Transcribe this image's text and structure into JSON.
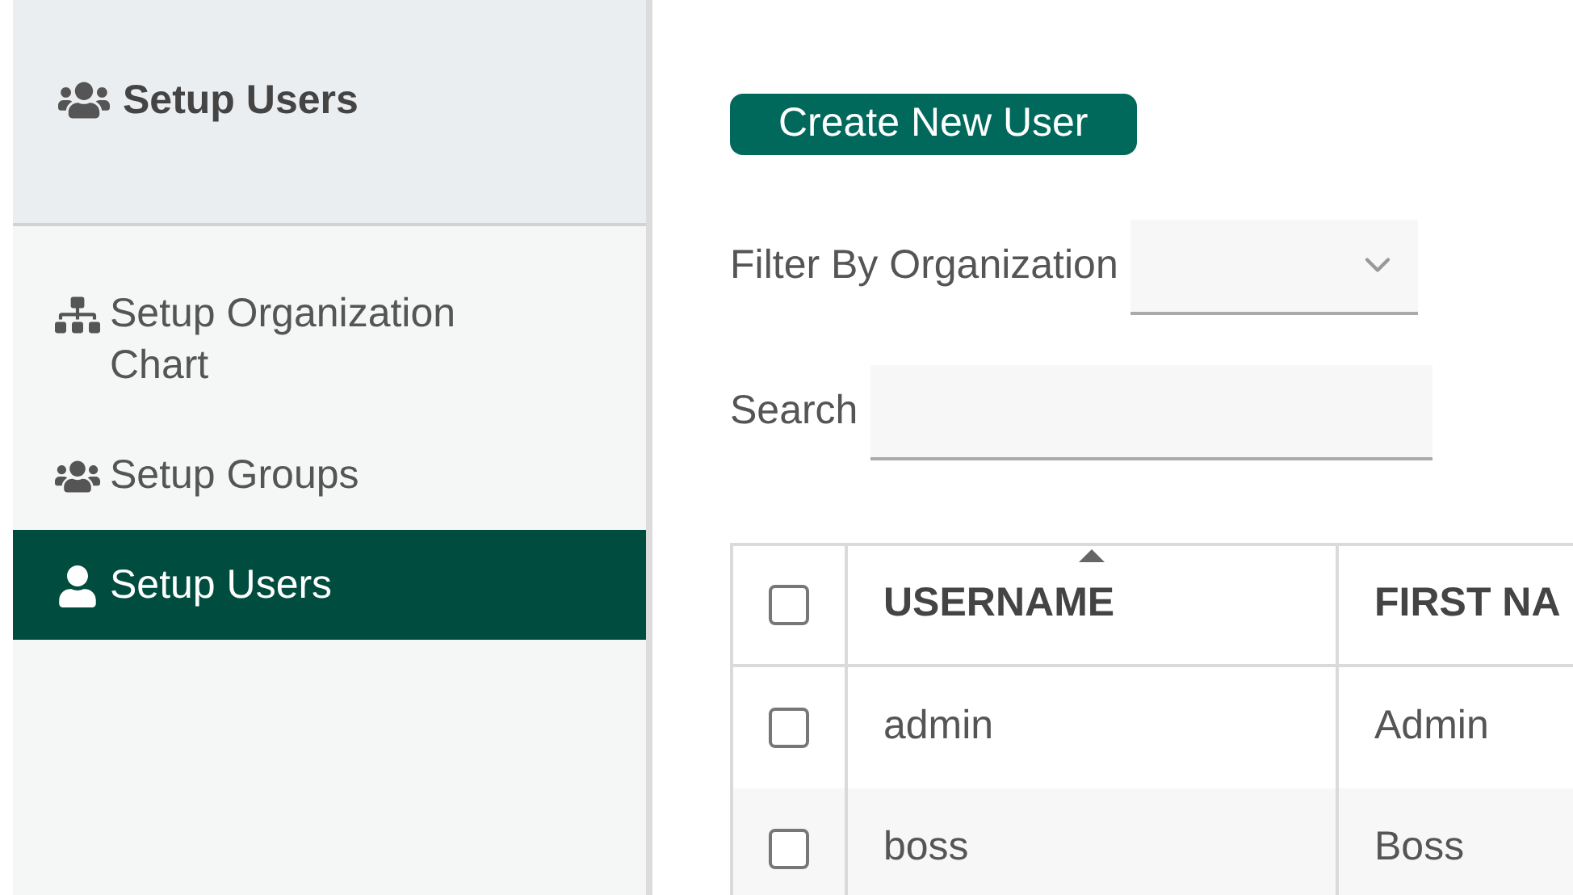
{
  "sidebar": {
    "header": {
      "title": "Setup Users",
      "kind": "groups"
    },
    "items": [
      {
        "label": "Setup Organization Chart",
        "kind": "org-chart",
        "selected": false
      },
      {
        "label": "Setup Groups",
        "kind": "groups",
        "selected": false
      },
      {
        "label": "Setup Users",
        "kind": "user",
        "selected": true
      }
    ]
  },
  "create_button": "Create New User",
  "filter": {
    "label": "Filter By Organization"
  },
  "search": {
    "label": "Search"
  },
  "table": {
    "select_all_checked": false,
    "columns": [
      {
        "label": "USERNAME",
        "sorted": true
      },
      {
        "label": "FIRST NA",
        "sorted": false
      }
    ],
    "rows": [
      {
        "checked": false,
        "cells": [
          "admin",
          "Admin"
        ]
      },
      {
        "checked": false,
        "cells": [
          "boss",
          "Boss"
        ]
      }
    ]
  }
}
